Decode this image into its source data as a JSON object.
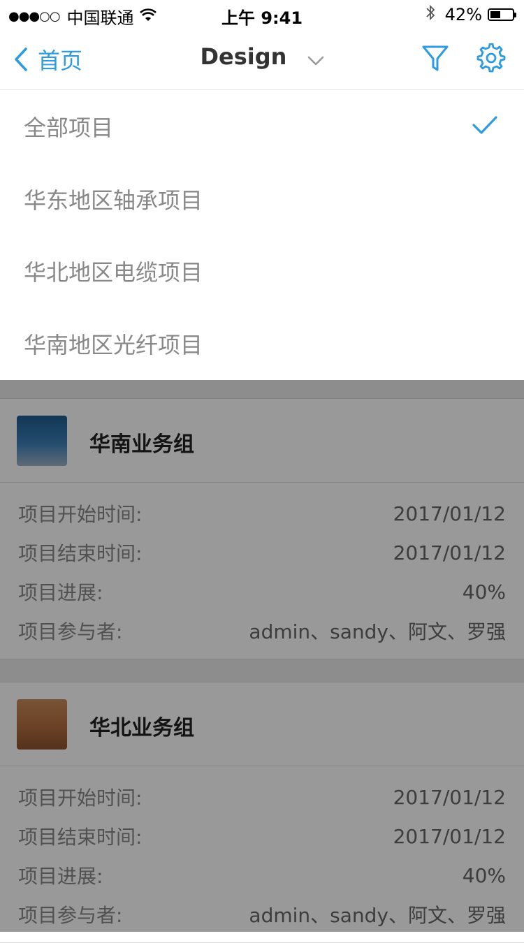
{
  "status_bar": {
    "signal": "●●●○○",
    "carrier": "中国联通",
    "time": "上午 9:41",
    "battery": "42%",
    "battery_level": 0.42
  },
  "nav": {
    "back_label": "首页",
    "title": "Design",
    "accent_color": "#2d9be0"
  },
  "dropdown": {
    "items": [
      {
        "label": "全部项目",
        "selected": true
      },
      {
        "label": "华东地区轴承项目",
        "selected": false
      },
      {
        "label": "华北地区电缆项目",
        "selected": false
      },
      {
        "label": "华南地区光纤项目",
        "selected": false
      }
    ]
  },
  "cards": [
    {
      "title": "华南业务组",
      "thumbnail": "spacecraft-over-earth",
      "rows": [
        {
          "label": "项目开始时间:",
          "value": "2017/01/12"
        },
        {
          "label": "项目结束时间:",
          "value": "2017/01/12"
        },
        {
          "label": "项目进展:",
          "value": "40%"
        },
        {
          "label": "项目参与者:",
          "value": "admin、sandy、阿文、罗强"
        }
      ]
    },
    {
      "title": "华北业务组",
      "thumbnail": "desert-sand",
      "rows": [
        {
          "label": "项目开始时间:",
          "value": "2017/01/12"
        },
        {
          "label": "项目结束时间:",
          "value": "2017/01/12"
        },
        {
          "label": "项目进展:",
          "value": "40%"
        },
        {
          "label": "项目参与者:",
          "value": "admin、sandy、阿文、罗强"
        }
      ]
    }
  ]
}
